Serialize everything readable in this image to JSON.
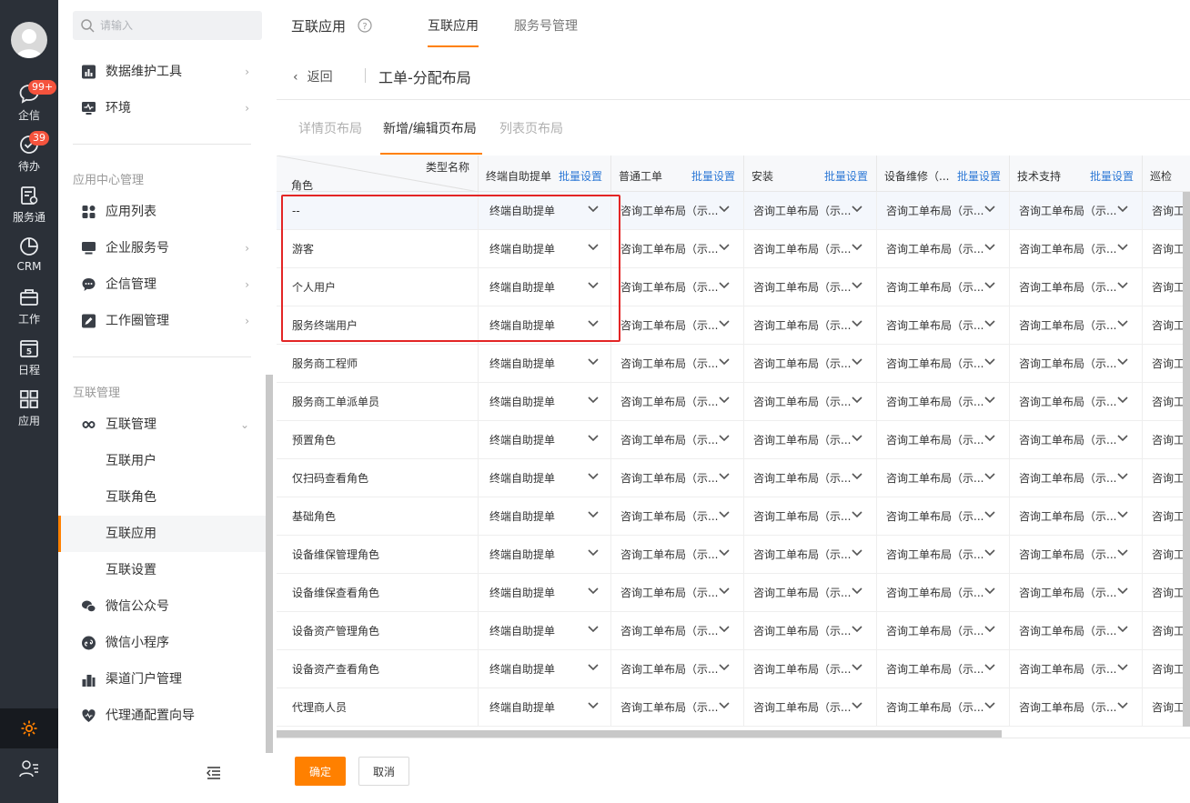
{
  "rail": {
    "items": [
      {
        "label": "企信",
        "icon": "chat-icon",
        "badge": "99+"
      },
      {
        "label": "待办",
        "icon": "check-circle-icon",
        "badge": "39"
      },
      {
        "label": "服务通",
        "icon": "service-icon"
      },
      {
        "label": "CRM",
        "icon": "crm-pie-icon"
      },
      {
        "label": "工作",
        "icon": "briefcase-icon"
      },
      {
        "label": "日程",
        "icon": "calendar-icon",
        "day": "5"
      },
      {
        "label": "应用",
        "icon": "apps-grid-icon"
      }
    ],
    "accent": "#ff8000",
    "background": "#2b3038"
  },
  "sidebar": {
    "search_placeholder": "请输入",
    "top_items": [
      {
        "label": "数据维护工具",
        "icon": "bar-chart-icon"
      },
      {
        "label": "环境",
        "icon": "monitor-icon"
      }
    ],
    "section_app_center": "应用中心管理",
    "app_items": [
      {
        "label": "应用列表",
        "icon": "grid-icon"
      },
      {
        "label": "企业服务号",
        "icon": "monitor-icon"
      },
      {
        "label": "企信管理",
        "icon": "chat-icon"
      },
      {
        "label": "工作圈管理",
        "icon": "edit-icon"
      }
    ],
    "section_interconnect": "互联管理",
    "interconnect_group": {
      "label": "互联管理",
      "icon": "link-icon"
    },
    "interconnect_sub": [
      "互联用户",
      "互联角色",
      "互联应用",
      "互联设置"
    ],
    "bottom_items": [
      {
        "label": "微信公众号",
        "icon": "wechat-icon"
      },
      {
        "label": "微信小程序",
        "icon": "mini-program-icon"
      },
      {
        "label": "渠道门户管理",
        "icon": "building-icon"
      },
      {
        "label": "代理通配置向导",
        "icon": "heart-icon"
      }
    ]
  },
  "header": {
    "app_title": "互联应用",
    "tabs": [
      "互联应用",
      "服务号管理"
    ],
    "back_label": "返回",
    "page_title": "工单-分配布局"
  },
  "sub_tabs": [
    "详情页布局",
    "新增/编辑页布局",
    "列表页布局"
  ],
  "table": {
    "corner_type": "类型名称",
    "corner_role": "角色",
    "batch_label": "批量设置",
    "columns": [
      "终端自助提单",
      "普通工单",
      "安装",
      "设备维修（...",
      "技术支持",
      "巡检"
    ],
    "default_first": "终端自助提单",
    "default_other": "咨询工单布局（示...",
    "last_col_value": "咨询工",
    "roles": [
      "--",
      "游客",
      "个人用户",
      "服务终端用户",
      "服务商工程师",
      "服务商工单派单员",
      "预置角色",
      "仅扫码查看角色",
      "基础角色",
      "设备维保管理角色",
      "设备维保查看角色",
      "设备资产管理角色",
      "设备资产查看角色",
      "代理商人员"
    ]
  },
  "footer": {
    "confirm": "确定",
    "cancel": "取消"
  }
}
